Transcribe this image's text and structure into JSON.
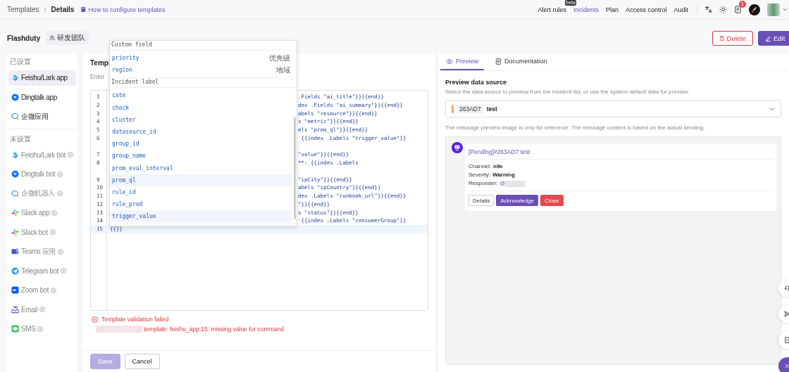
{
  "nav": {
    "breadcrumb": [
      {
        "label": "Templates",
        "current": false
      },
      {
        "label": "Details",
        "current": true
      }
    ],
    "help_link": "How to configure templates",
    "menu": [
      {
        "label": "Alert rules",
        "badge": "beta",
        "selected": false
      },
      {
        "label": "Incidents",
        "selected": true
      },
      {
        "label": "Plan",
        "selected": false
      },
      {
        "label": "Access control",
        "selected": false
      },
      {
        "label": "Audit",
        "selected": false
      }
    ],
    "notification_count": "1"
  },
  "header": {
    "title": "Flashduty",
    "team": "研发团队",
    "buttons": [
      {
        "label": "Delete",
        "kind": "danger"
      },
      {
        "label": "Edit",
        "kind": "primary"
      }
    ]
  },
  "sidebar": {
    "groups": [
      {
        "title": "已设置",
        "configured": true,
        "items": [
          {
            "label": "Feishu/Lark app",
            "kind": "feishu",
            "selected": true
          },
          {
            "label": "Dingtalk app",
            "kind": "dingtalk",
            "selected": false
          },
          {
            "label": "企微应用",
            "kind": "wecom",
            "selected": false
          }
        ]
      },
      {
        "title": "未设置",
        "configured": false,
        "items": [
          {
            "label": "Feishu/Lark bot",
            "kind": "feishu",
            "selected": false
          },
          {
            "label": "Dingtalk bot",
            "kind": "dingtalk",
            "selected": false
          },
          {
            "label": "企微机器人",
            "kind": "wecom",
            "selected": false
          },
          {
            "label": "Slack app",
            "kind": "slack",
            "selected": false
          },
          {
            "label": "Slack bot",
            "kind": "slack",
            "selected": false
          },
          {
            "label": "Teams 应用",
            "kind": "teams",
            "selected": false
          },
          {
            "label": "Telegram bot",
            "kind": "telegram",
            "selected": false
          },
          {
            "label": "Zoom bot",
            "kind": "zoom",
            "selected": false
          },
          {
            "label": "Email",
            "kind": "email",
            "selected": false
          },
          {
            "label": "SMS",
            "kind": "sms",
            "selected": false
          }
        ]
      }
    ]
  },
  "editor": {
    "title": "Templ",
    "hint": "Enter",
    "lines": [
      {
        "number": "1",
        "kind": "partial",
        "text": ".Fields \"ai_title\"}}{{end}}",
        "wraps": false,
        "current": false
      },
      {
        "number": "2",
        "kind": "partial",
        "text": "dex .Fields \"ai_summary\"}}{{end}}",
        "wraps": false,
        "current": false
      },
      {
        "number": "3",
        "kind": "partial",
        "text": "abels \"resource\"}}{{end}}",
        "wraps": false,
        "current": false
      },
      {
        "number": "4",
        "kind": "partial",
        "text": "s \"metric\"}}{{end}}",
        "wraps": false,
        "current": false
      },
      {
        "number": "5",
        "kind": "partial",
        "text": "els \"prom_ql\"}}{{end}}",
        "wraps": false,
        "current": false
      },
      {
        "number": "6",
        "kind": "partial",
        "text": " {{index .Labels \"trigger_value\"}}",
        "wraps": true,
        "current": false
      },
      {
        "number": "7",
        "kind": "partial",
        "text": "\"value\"}}{{end}}",
        "wraps": false,
        "current": false
      },
      {
        "number": "8",
        "kind": "partial",
        "text": "**: {{index .Labels",
        "wraps": true,
        "current": false
      },
      {
        "number": "9",
        "kind": "partial",
        "text": "\"ipCity\"}}{{end}}",
        "wraps": false,
        "current": false
      },
      {
        "number": "10",
        "kind": "partial",
        "text": "abels \"ipCountry\"}}{{end}}",
        "wraps": false,
        "current": false
      },
      {
        "number": "11",
        "kind": "partial",
        "text": "dex .Labels \"runbook_url\"}}{{end}}",
        "wraps": false,
        "current": false
      },
      {
        "number": "12",
        "kind": "partial",
        "text": "\"}}{{end}}",
        "wraps": false,
        "current": false
      },
      {
        "number": "13",
        "kind": "partial",
        "text": "s \"status\"}}{{end}}",
        "wraps": false,
        "current": false
      },
      {
        "number": "14",
        "kind": "partial",
        "text": " {{index .Labels \"consumerGroup\"}}",
        "wraps": false,
        "current": false
      },
      {
        "number": "15",
        "kind": "full",
        "text": "{{}}",
        "wraps": false,
        "current": true
      }
    ],
    "error": {
      "title": "Template validation failed",
      "detail": "template: feishu_app:15: missing value for command"
    },
    "buttons": [
      {
        "label": "Save",
        "disabled": true
      },
      {
        "label": "Cancel",
        "disabled": false
      }
    ]
  },
  "autocomplete": {
    "sections": [
      {
        "title": "Custom field",
        "items": [
          {
            "name": "priority",
            "description": "优先级",
            "highlighted": false
          },
          {
            "name": "region",
            "description": "地域",
            "highlighted": false
          }
        ]
      },
      {
        "title": "Incident label",
        "items": [
          {
            "name": "cate",
            "highlighted": false
          },
          {
            "name": "check",
            "highlighted": false
          },
          {
            "name": "cluster",
            "highlighted": false
          },
          {
            "name": "datasource_id",
            "highlighted": false
          },
          {
            "name": "group_id",
            "highlighted": false
          },
          {
            "name": "group_name",
            "highlighted": false
          },
          {
            "name": "prom_eval_interval",
            "highlighted": false
          },
          {
            "name": "prom_ql",
            "highlighted": true
          },
          {
            "name": "rule_id",
            "highlighted": false
          },
          {
            "name": "rule_prod",
            "highlighted": false
          },
          {
            "name": "trigger_value",
            "highlighted": true
          }
        ]
      }
    ]
  },
  "preview": {
    "tabs": [
      {
        "label": "Preview",
        "kind": "eye",
        "selected": true
      },
      {
        "label": "Documentation",
        "kind": "doc",
        "selected": false
      }
    ],
    "heading": "Preview data source",
    "description": "Select the data source to preview from the incident list, or use the system default data for preview.",
    "source": {
      "id": "263AD7",
      "title": "test",
      "color": "#f7a572"
    },
    "note": "The message preview image is only for reference. The message content is based on the actual sending.",
    "message": {
      "title": "[Pending]#263AD7 test",
      "fields": [
        {
          "label": "Channel:",
          "value": "n9e",
          "kind": "text"
        },
        {
          "label": "Severity:",
          "value": "Warning",
          "kind": "text"
        },
        {
          "label": "Responder:",
          "value": "@",
          "kind": "mention"
        }
      ],
      "actions": [
        {
          "label": "Details",
          "kind": "default"
        },
        {
          "label": "Acknowledge",
          "kind": "primary"
        },
        {
          "label": "Close",
          "kind": "danger"
        }
      ]
    }
  }
}
